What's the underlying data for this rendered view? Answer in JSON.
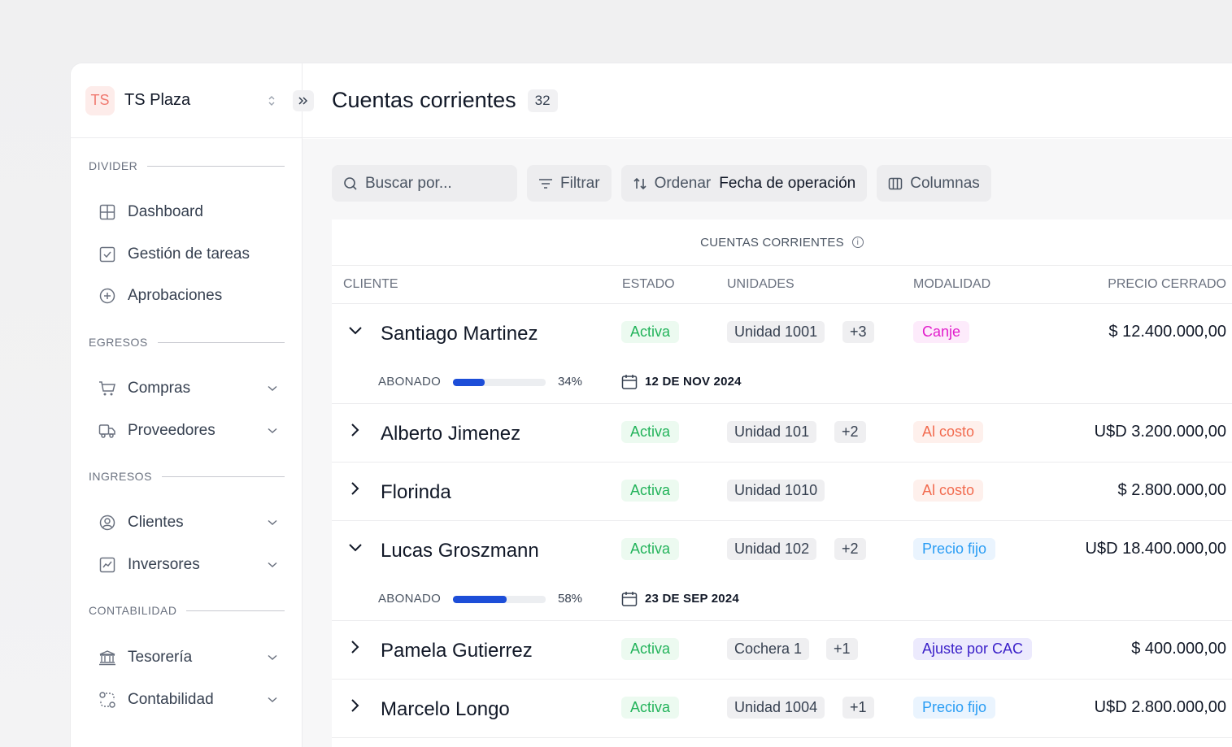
{
  "workspace": {
    "logo": "TS",
    "name": "TS Plaza"
  },
  "sidebar": {
    "sections": [
      {
        "title": "DIVIDER",
        "items": [
          {
            "label": "Dashboard",
            "icon": "grid-icon",
            "has_children": false
          },
          {
            "label": "Gestión de tareas",
            "icon": "checkbox-icon",
            "has_children": false
          },
          {
            "label": "Aprobaciones",
            "icon": "plus-circle-icon",
            "has_children": false
          }
        ]
      },
      {
        "title": "EGRESOS",
        "items": [
          {
            "label": "Compras",
            "icon": "cart-icon",
            "has_children": true
          },
          {
            "label": "Proveedores",
            "icon": "truck-icon",
            "has_children": true
          }
        ]
      },
      {
        "title": "INGRESOS",
        "items": [
          {
            "label": "Clientes",
            "icon": "user-circle-icon",
            "has_children": true
          },
          {
            "label": "Inversores",
            "icon": "chart-icon",
            "has_children": true
          }
        ]
      },
      {
        "title": "CONTABILIDAD",
        "items": [
          {
            "label": "Tesorería",
            "icon": "bank-icon",
            "has_children": true
          },
          {
            "label": "Contabilidad",
            "icon": "cycle-icon",
            "has_children": true
          }
        ]
      }
    ]
  },
  "header": {
    "title": "Cuentas corrientes",
    "count": "32"
  },
  "toolbar": {
    "search_placeholder": "Buscar por...",
    "filter_label": "Filtrar",
    "sort_label": "Ordenar",
    "sort_value": "Fecha de operación",
    "columns_label": "Columnas"
  },
  "table": {
    "caption": "CUENTAS CORRIENTES",
    "columns": {
      "cliente": "CLIENTE",
      "estado": "ESTADO",
      "unidades": "UNIDADES",
      "modalidad": "MODALIDAD",
      "precio": "PRECIO CERRADO"
    },
    "rows": [
      {
        "cliente": "Santiago Martinez",
        "estado": "Activa",
        "unidad": "Unidad 1001",
        "extra": "+3",
        "modalidad": "Canje",
        "modalidad_color": "#e11dcb",
        "modalidad_bg": "#fdebfb",
        "precio": "$ 12.400.000,00",
        "expanded": true,
        "abonado_label": "ABONADO",
        "abonado_pct": 34,
        "abonado_text": "34%",
        "fecha": "12 DE NOV 2024"
      },
      {
        "cliente": "Alberto Jimenez",
        "estado": "Activa",
        "unidad": "Unidad 101",
        "extra": "+2",
        "modalidad": "Al costo",
        "modalidad_color": "#f26b4f",
        "modalidad_bg": "#fef0ec",
        "precio": "U$D 3.200.000,00",
        "expanded": false
      },
      {
        "cliente": "Florinda",
        "estado": "Activa",
        "unidad": "Unidad 1010",
        "extra": "",
        "modalidad": "Al costo",
        "modalidad_color": "#f26b4f",
        "modalidad_bg": "#fef0ec",
        "precio": "$ 2.800.000,00",
        "expanded": false
      },
      {
        "cliente": "Lucas Groszmann",
        "estado": "Activa",
        "unidad": "Unidad 102",
        "extra": "+2",
        "modalidad": "Precio fijo",
        "modalidad_color": "#2a9df4",
        "modalidad_bg": "#eaf4fe",
        "precio": "U$D 18.400.000,00",
        "expanded": true,
        "abonado_label": "ABONADO",
        "abonado_pct": 58,
        "abonado_text": "58%",
        "fecha": "23 DE SEP 2024"
      },
      {
        "cliente": "Pamela Gutierrez",
        "estado": "Activa",
        "unidad": "Cochera 1",
        "extra": "+1",
        "modalidad": "Ajuste por CAC",
        "modalidad_color": "#3b21c9",
        "modalidad_bg": "#eceafd",
        "precio": "$ 400.000,00",
        "expanded": false
      },
      {
        "cliente": "Marcelo Longo",
        "estado": "Activa",
        "unidad": "Unidad 1004",
        "extra": "+1",
        "modalidad": "Precio fijo",
        "modalidad_color": "#2a9df4",
        "modalidad_bg": "#eaf4fe",
        "precio": "U$D 2.800.000,00",
        "expanded": false
      }
    ]
  }
}
